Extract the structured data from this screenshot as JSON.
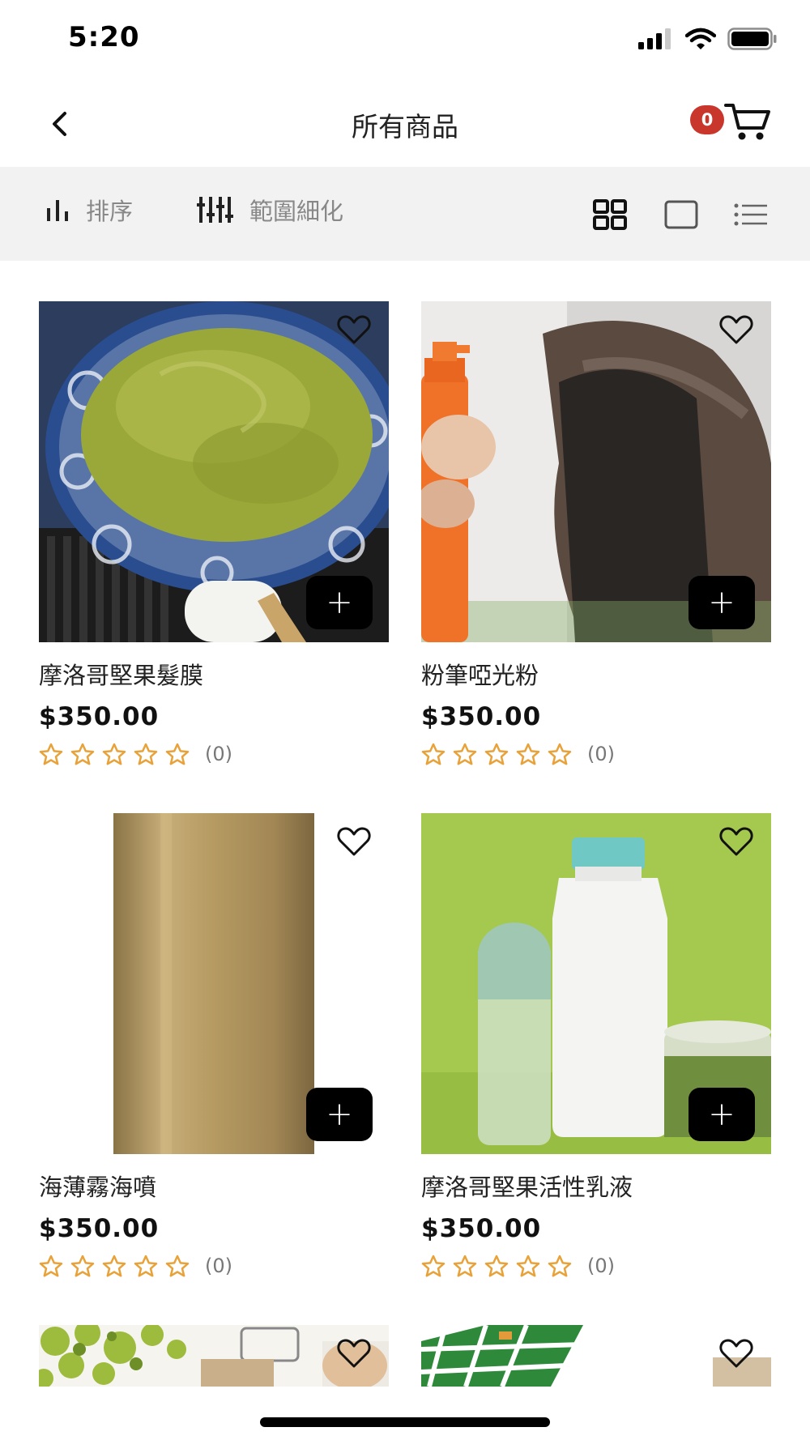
{
  "status_bar": {
    "time": "5:20"
  },
  "header": {
    "title": "所有商品",
    "cart_count": "0"
  },
  "toolbar": {
    "sort_label": "排序",
    "filter_label": "範圍細化"
  },
  "products": [
    {
      "name": "摩洛哥堅果髮膜",
      "price": "$350.00",
      "rating": 0,
      "reviews": "(0)",
      "add_label": "+"
    },
    {
      "name": "粉筆啞光粉",
      "price": "$350.00",
      "rating": 0,
      "reviews": "(0)",
      "add_label": "+"
    },
    {
      "name": "海薄霧海噴",
      "price": "$350.00",
      "rating": 0,
      "reviews": "(0)",
      "add_label": "+"
    },
    {
      "name": "摩洛哥堅果活性乳液",
      "price": "$350.00",
      "rating": 0,
      "reviews": "(0)",
      "add_label": "+"
    }
  ],
  "colors": {
    "badge": "#c8362c",
    "star": "#e8a23a",
    "toolbar_bg": "#f2f2f2"
  }
}
